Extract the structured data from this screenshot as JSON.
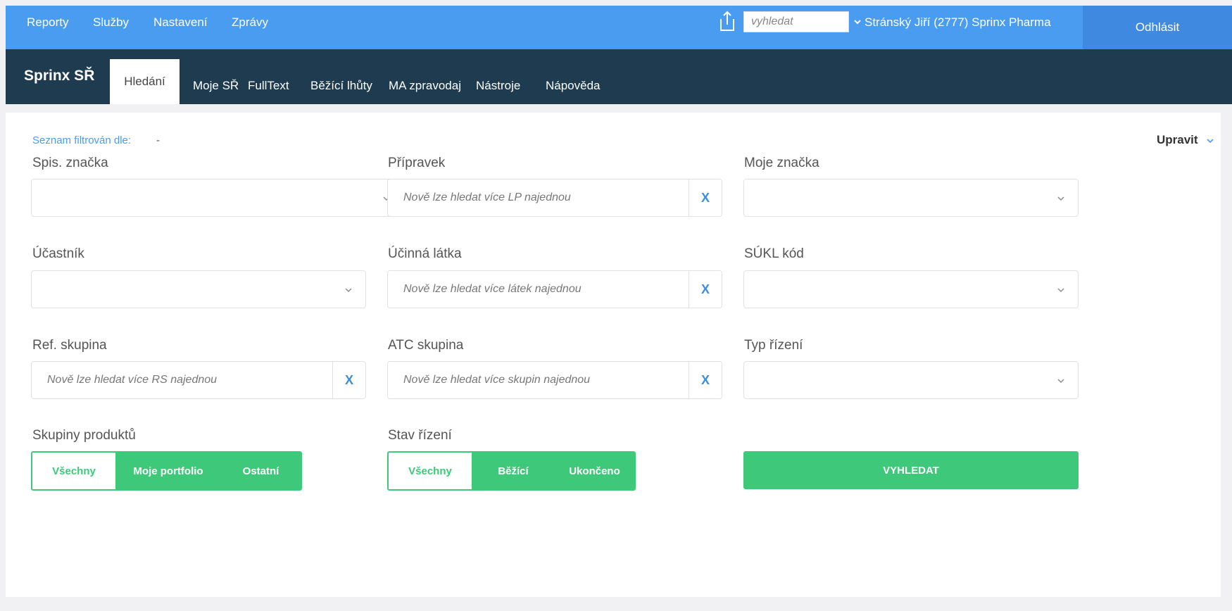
{
  "topbar": {
    "links": [
      "Reporty",
      "Služby",
      "Nastavení",
      "Zprávy"
    ],
    "search_placeholder": "vyhledat",
    "user": "Stránský Jiří (2777) Sprinx Pharma",
    "logout": "Odhlásit"
  },
  "navbar": {
    "brand": "Sprinx SŘ",
    "items": [
      "Hledání",
      "Moje SŘ",
      "FullText",
      "Běžící lhůty",
      "MA zpravodaj",
      "Nástroje",
      "Nápověda"
    ],
    "active_index": 0
  },
  "filter": {
    "label": "Seznam filtrován dle:",
    "value": "-",
    "edit": "Upravit"
  },
  "fields": {
    "spis_znacka": {
      "label": "Spis. značka",
      "placeholder": ""
    },
    "pripravek": {
      "label": "Přípravek",
      "placeholder": "Nově lze hledat více LP najednou"
    },
    "moje_znacka": {
      "label": "Moje značka",
      "placeholder": ""
    },
    "ucastnik": {
      "label": "Účastník",
      "placeholder": ""
    },
    "ucinna_latka": {
      "label": "Účinná látka",
      "placeholder": "Nově lze hledat více látek najednou"
    },
    "sukl_kod": {
      "label": "SÚKL kód",
      "placeholder": ""
    },
    "ref_skupina": {
      "label": "Ref. skupina",
      "placeholder": "Nově lze hledat více RS najednou"
    },
    "atc_skupina": {
      "label": "ATC skupina",
      "placeholder": "Nově lze hledat více skupin najednou"
    },
    "typ_rizeni": {
      "label": "Typ řízení",
      "placeholder": ""
    }
  },
  "product_groups": {
    "label": "Skupiny produktů",
    "options": [
      "Všechny",
      "Moje portfolio",
      "Ostatní"
    ],
    "selected": "Všechny"
  },
  "procedure_state": {
    "label": "Stav řízení",
    "options": [
      "Všechny",
      "Běžící",
      "Ukončeno"
    ],
    "selected": "Všechny"
  },
  "search_button": "VYHLEDAT",
  "clear_symbol": "X",
  "colors": {
    "topbar": "#4a9cf0",
    "navbar": "#1e3b50",
    "accent_green": "#3ec97a",
    "link_blue": "#4a9cf0"
  }
}
